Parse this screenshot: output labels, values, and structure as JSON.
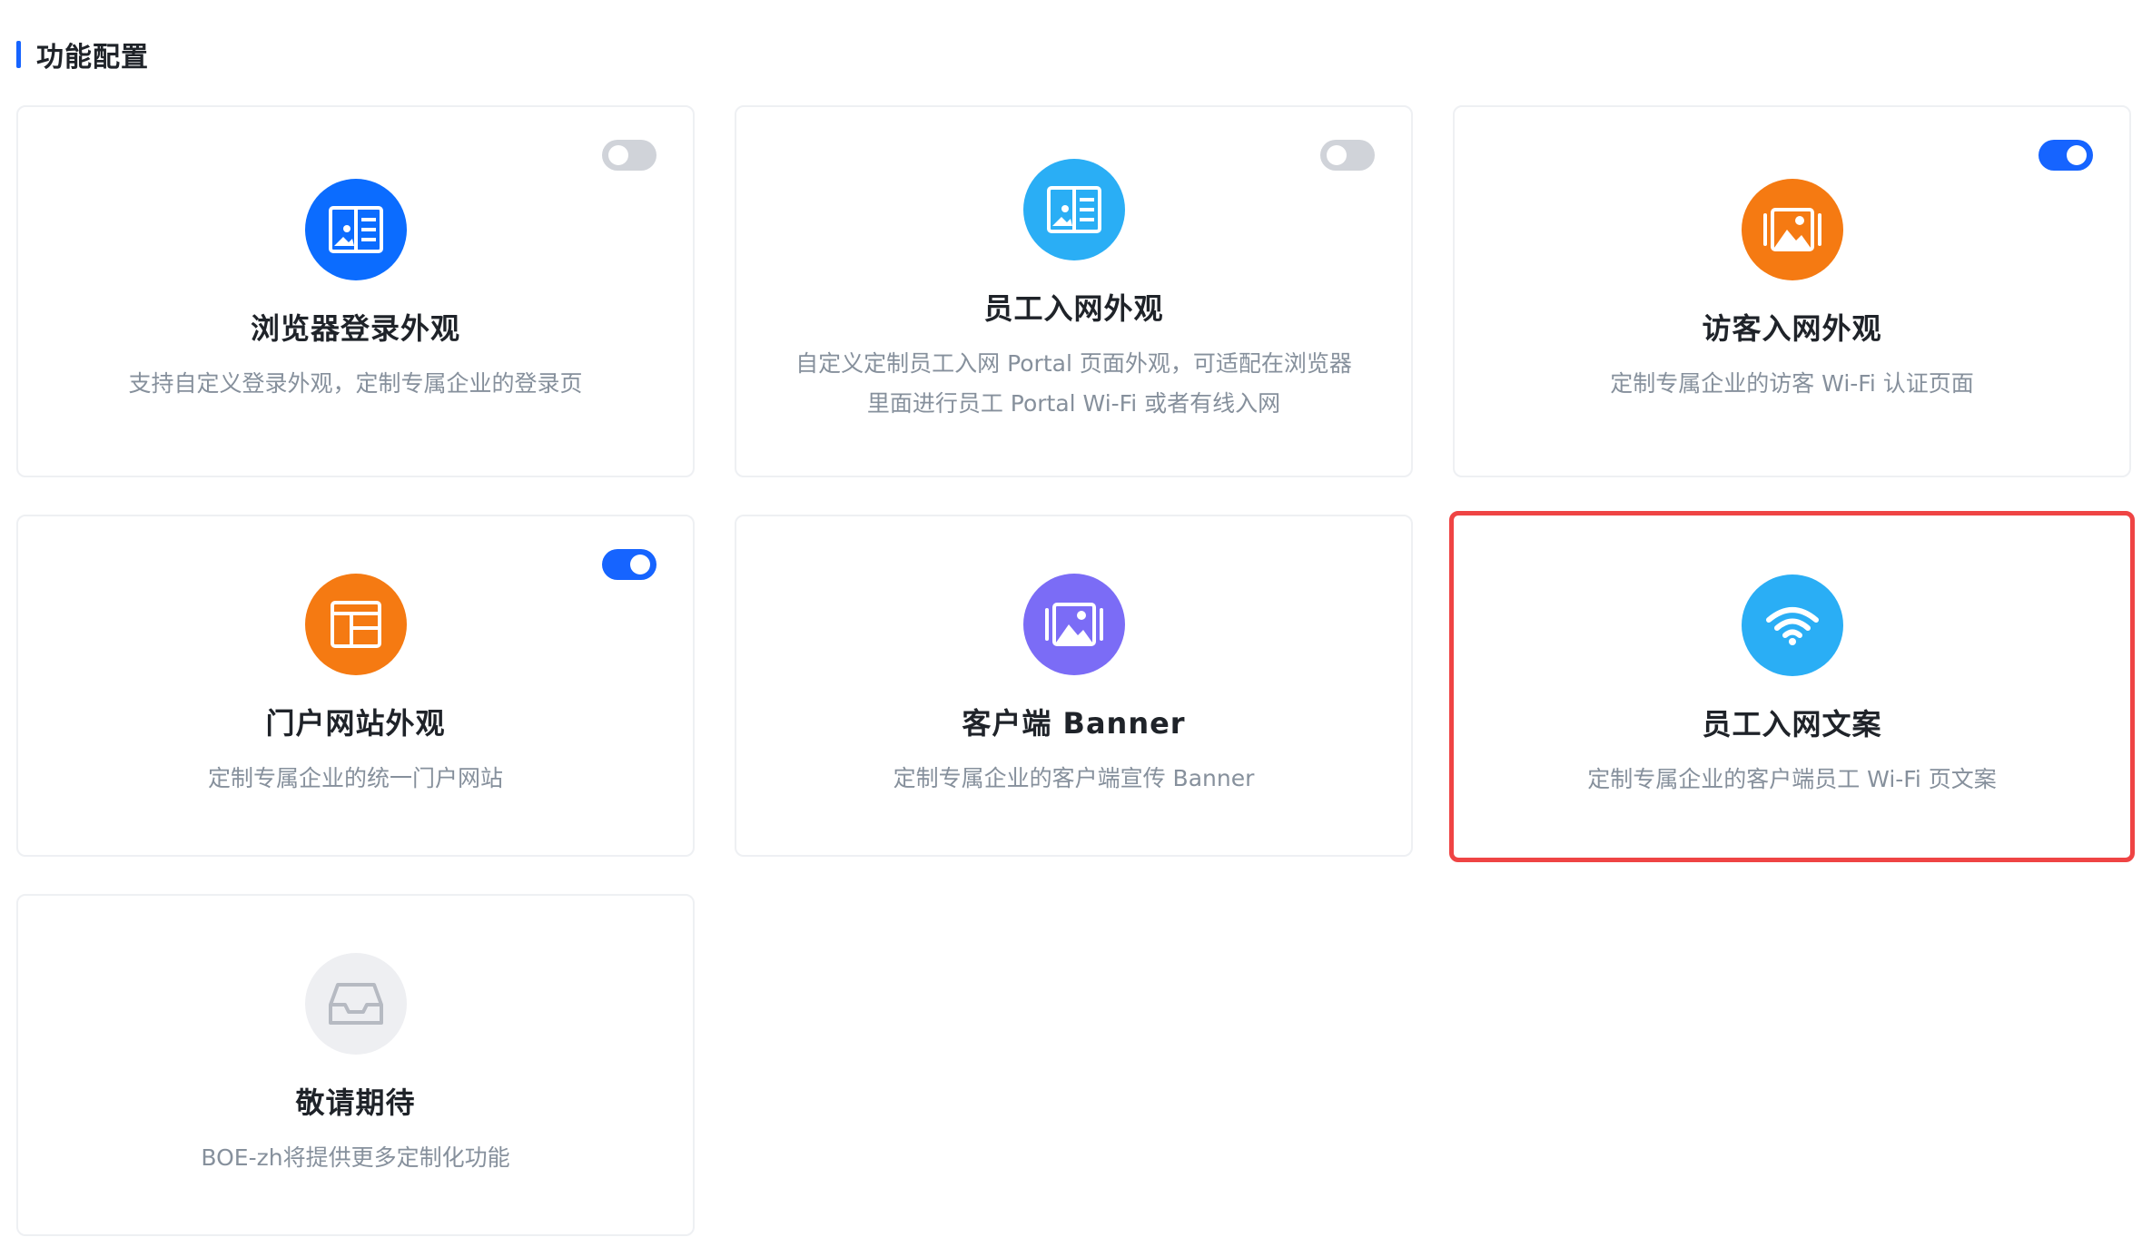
{
  "section": {
    "title": "功能配置"
  },
  "colors": {
    "accent": "#1664ff",
    "highlight_border": "#ef4444",
    "blue": "#0b6cff",
    "sky": "#2aaef5",
    "orange": "#f57a12",
    "purple": "#7b6cf6",
    "gray": "#eeeff2"
  },
  "cards": [
    {
      "title": "浏览器登录外观",
      "desc_lines": [
        "支持自定义登录外观，定制专属企业的登录页"
      ],
      "icon": "book-open-icon",
      "toggle": "off"
    },
    {
      "title": "员工入网外观",
      "desc_lines": [
        "自定义定制员工入网 Portal 页面外观，可适配在浏览器",
        "里面进行员工 Portal Wi-Fi 或者有线入网"
      ],
      "icon": "book-open-icon",
      "toggle": "off"
    },
    {
      "title": "访客入网外观",
      "desc_lines": [
        "定制专属企业的访客 Wi-Fi 认证页面"
      ],
      "icon": "image-gallery-icon",
      "toggle": "on"
    },
    {
      "title": "门户网站外观",
      "desc_lines": [
        "定制专属企业的统一门户网站"
      ],
      "icon": "layout-icon",
      "toggle": "on"
    },
    {
      "title": "客户端 Banner",
      "desc_lines": [
        "定制专属企业的客户端宣传 Banner"
      ],
      "icon": "image-gallery-icon",
      "toggle": null
    },
    {
      "title": "员工入网文案",
      "desc_lines": [
        "定制专属企业的客户端员工 Wi-Fi 页文案"
      ],
      "icon": "wifi-icon",
      "toggle": null
    },
    {
      "title": "敬请期待",
      "desc_lines": [
        "BOE-zh将提供更多定制化功能"
      ],
      "icon": "inbox-icon",
      "toggle": null
    }
  ]
}
